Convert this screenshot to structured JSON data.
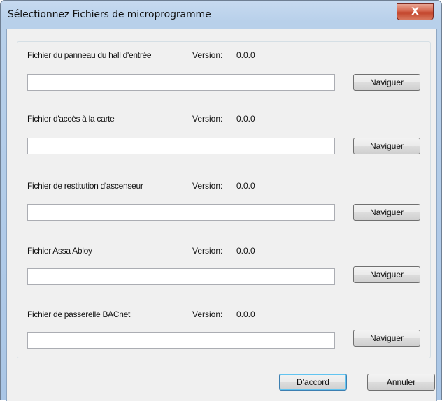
{
  "window": {
    "title": "Sélectionnez Fichiers de microprogramme",
    "close_glyph": "X"
  },
  "files": [
    {
      "label": "Fichier du panneau du hall d'entrée",
      "version_label": "Version:",
      "version": "0.0.0",
      "path": "",
      "browse_label": "Naviguer"
    },
    {
      "label": "Fichier d'accès à la carte",
      "version_label": "Version:",
      "version": "0.0.0",
      "path": "",
      "browse_label": "Naviguer"
    },
    {
      "label": "Fichier de restitution d'ascenseur",
      "version_label": "Version:",
      "version": "0.0.0",
      "path": "",
      "browse_label": "Naviguer"
    },
    {
      "label": "Fichier Assa Abloy",
      "version_label": "Version:",
      "version": "0.0.0",
      "path": "",
      "browse_label": "Naviguer"
    },
    {
      "label": "Fichier de passerelle BACnet",
      "version_label": "Version:",
      "version": "0.0.0",
      "path": "",
      "browse_label": "Naviguer"
    }
  ],
  "footer": {
    "ok_mnemonic": "D",
    "ok_rest": "'accord",
    "cancel_mnemonic": "A",
    "cancel_rest": "nnuler"
  }
}
